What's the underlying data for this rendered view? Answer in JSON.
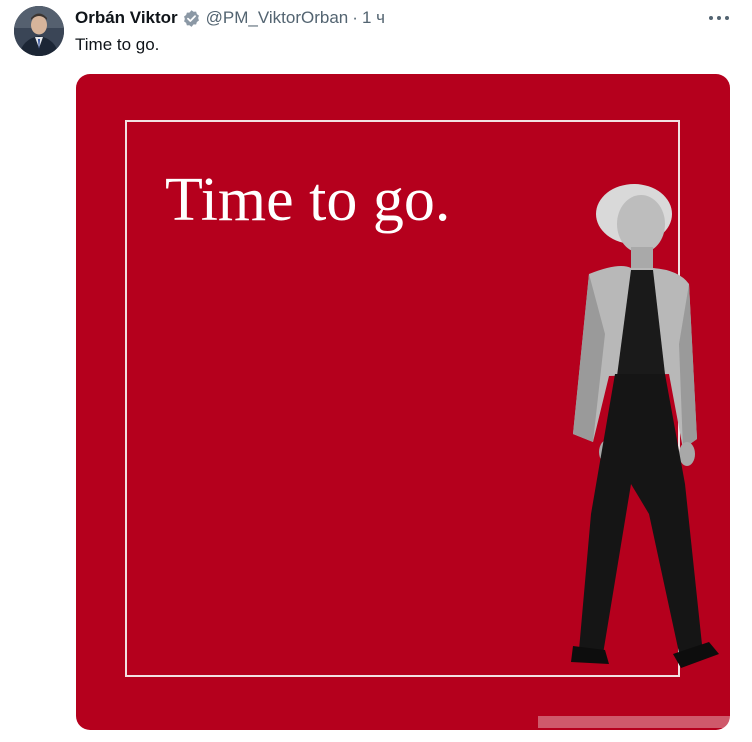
{
  "tweet": {
    "author_name": "Orbán Viktor",
    "handle": "@PM_ViktorOrban",
    "separator": "·",
    "time": "1 ч",
    "text": "Time to go."
  },
  "media": {
    "headline": "Time to go.",
    "background_color": "#b5001d"
  },
  "icons": {
    "verified": "verified-badge-icon",
    "more": "more-options-icon"
  }
}
